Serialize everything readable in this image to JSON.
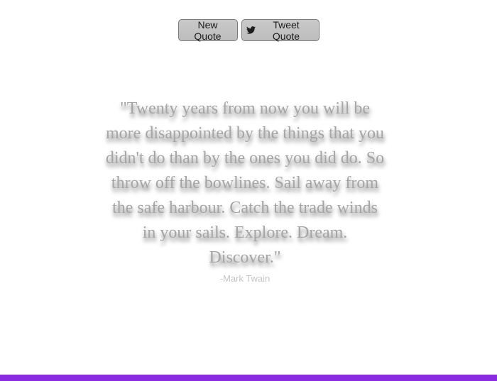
{
  "toolbar": {
    "new_quote_label": "New Quote",
    "tweet_quote_label": "Tweet Quote",
    "tweet_icon": "twitter-icon"
  },
  "quote": {
    "text": "\"Twenty years from now you will be more disappointed by the things that you didn't do than by the ones you did do. So throw off the bowlines. Sail away from the safe harbour. Catch the trade winds in your sails. Explore. Dream. Discover.\"",
    "author": "-Mark Twain"
  },
  "colors": {
    "accent_bar": "#8a2be2",
    "quote_text": "#a5a5a5",
    "author_text": "#c6c6c6"
  }
}
